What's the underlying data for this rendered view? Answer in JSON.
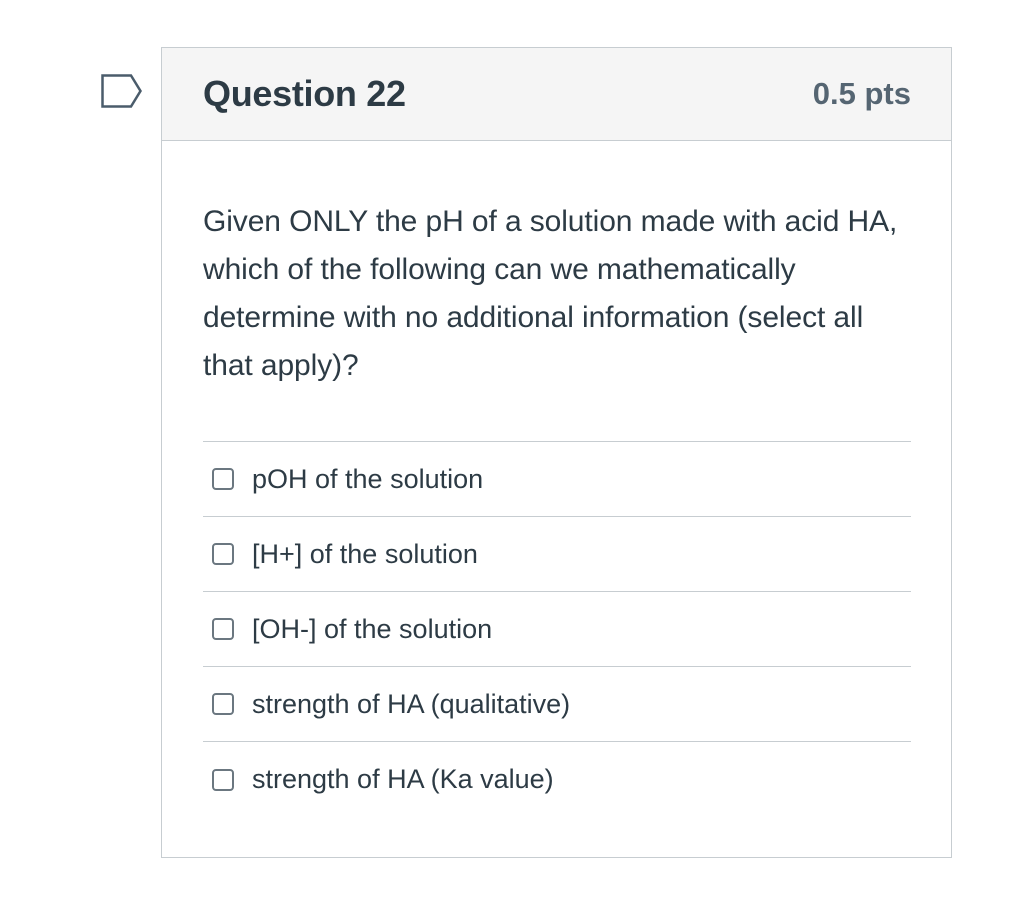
{
  "flag": {
    "icon": "flag-outline-icon",
    "color": "#4a5c6b"
  },
  "question": {
    "title": "Question 22",
    "points": "0.5 pts",
    "text": "Given ONLY the pH of a solution made with acid HA, which of the following can we mathematically determine with no additional information (select all that apply)?"
  },
  "answers": [
    {
      "label": "pOH of the solution",
      "checked": false
    },
    {
      "label": "[H+] of the solution",
      "checked": false
    },
    {
      "label": "[OH-] of the solution",
      "checked": false
    },
    {
      "label": "strength of HA (qualitative)",
      "checked": false
    },
    {
      "label": "strength of HA (Ka value)",
      "checked": false
    }
  ],
  "colors": {
    "text": "#2d3b45",
    "points": "#556572",
    "border": "#c7cdd1",
    "header_bg": "#f5f5f5"
  }
}
